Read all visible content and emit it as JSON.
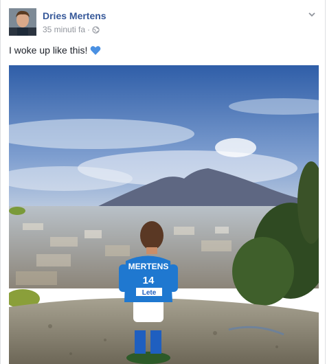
{
  "post": {
    "author": "Dries Mertens",
    "timestamp": "35 minuti fa",
    "separator": "·",
    "audience_icon": "globe-icon",
    "text": "I woke up like this!",
    "emoji": "blue-heart",
    "menu_icon": "chevron-down-icon"
  },
  "photo": {
    "jersey_name": "MERTENS",
    "jersey_number": "14",
    "sponsor": "Lete",
    "colors": {
      "jersey": "#1f78d0",
      "sky": "#3f6fb5",
      "accent_link": "#365899"
    }
  }
}
